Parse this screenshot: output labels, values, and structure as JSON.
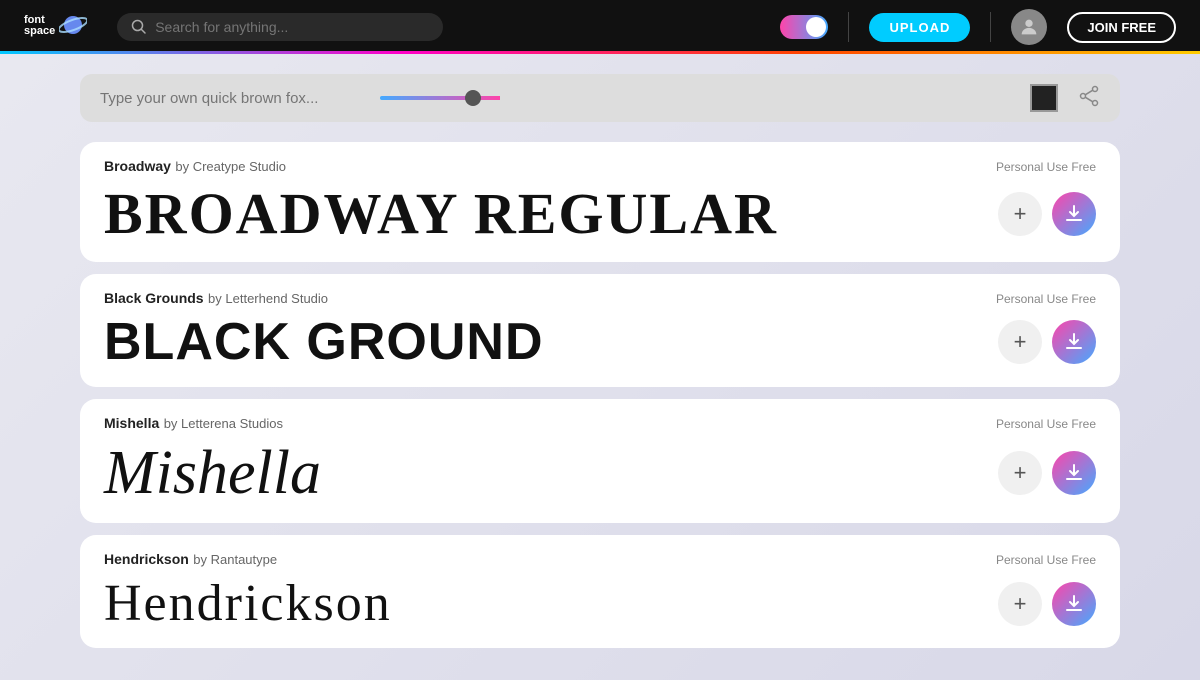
{
  "header": {
    "logo_text_font": "font",
    "logo_text_space": "space",
    "search_placeholder": "Search for anything...",
    "upload_label": "UPLOAD",
    "join_label": "JOIN FREE"
  },
  "preview_bar": {
    "input_placeholder": "Type your own quick brown fox...",
    "share_label": "share"
  },
  "fonts": [
    {
      "name": "Broadway",
      "by": "by Creatype Studio",
      "license": "Personal Use Free",
      "preview": "Broadway Regular",
      "style": "broadway"
    },
    {
      "name": "Black Grounds",
      "by": "by Letterhend Studio",
      "license": "Personal Use Free",
      "preview": "BLACK GROUND",
      "style": "blackground"
    },
    {
      "name": "Mishella",
      "by": "by Letterena Studios",
      "license": "Personal Use Free",
      "preview": "Mishella",
      "style": "mishella"
    },
    {
      "name": "Hendrickson",
      "by": "by Rantautype",
      "license": "Personal Use Free",
      "preview": "Hendrickson",
      "style": "hendrickson"
    }
  ],
  "icons": {
    "search": "🔍",
    "plus": "+",
    "share": "⇄"
  }
}
